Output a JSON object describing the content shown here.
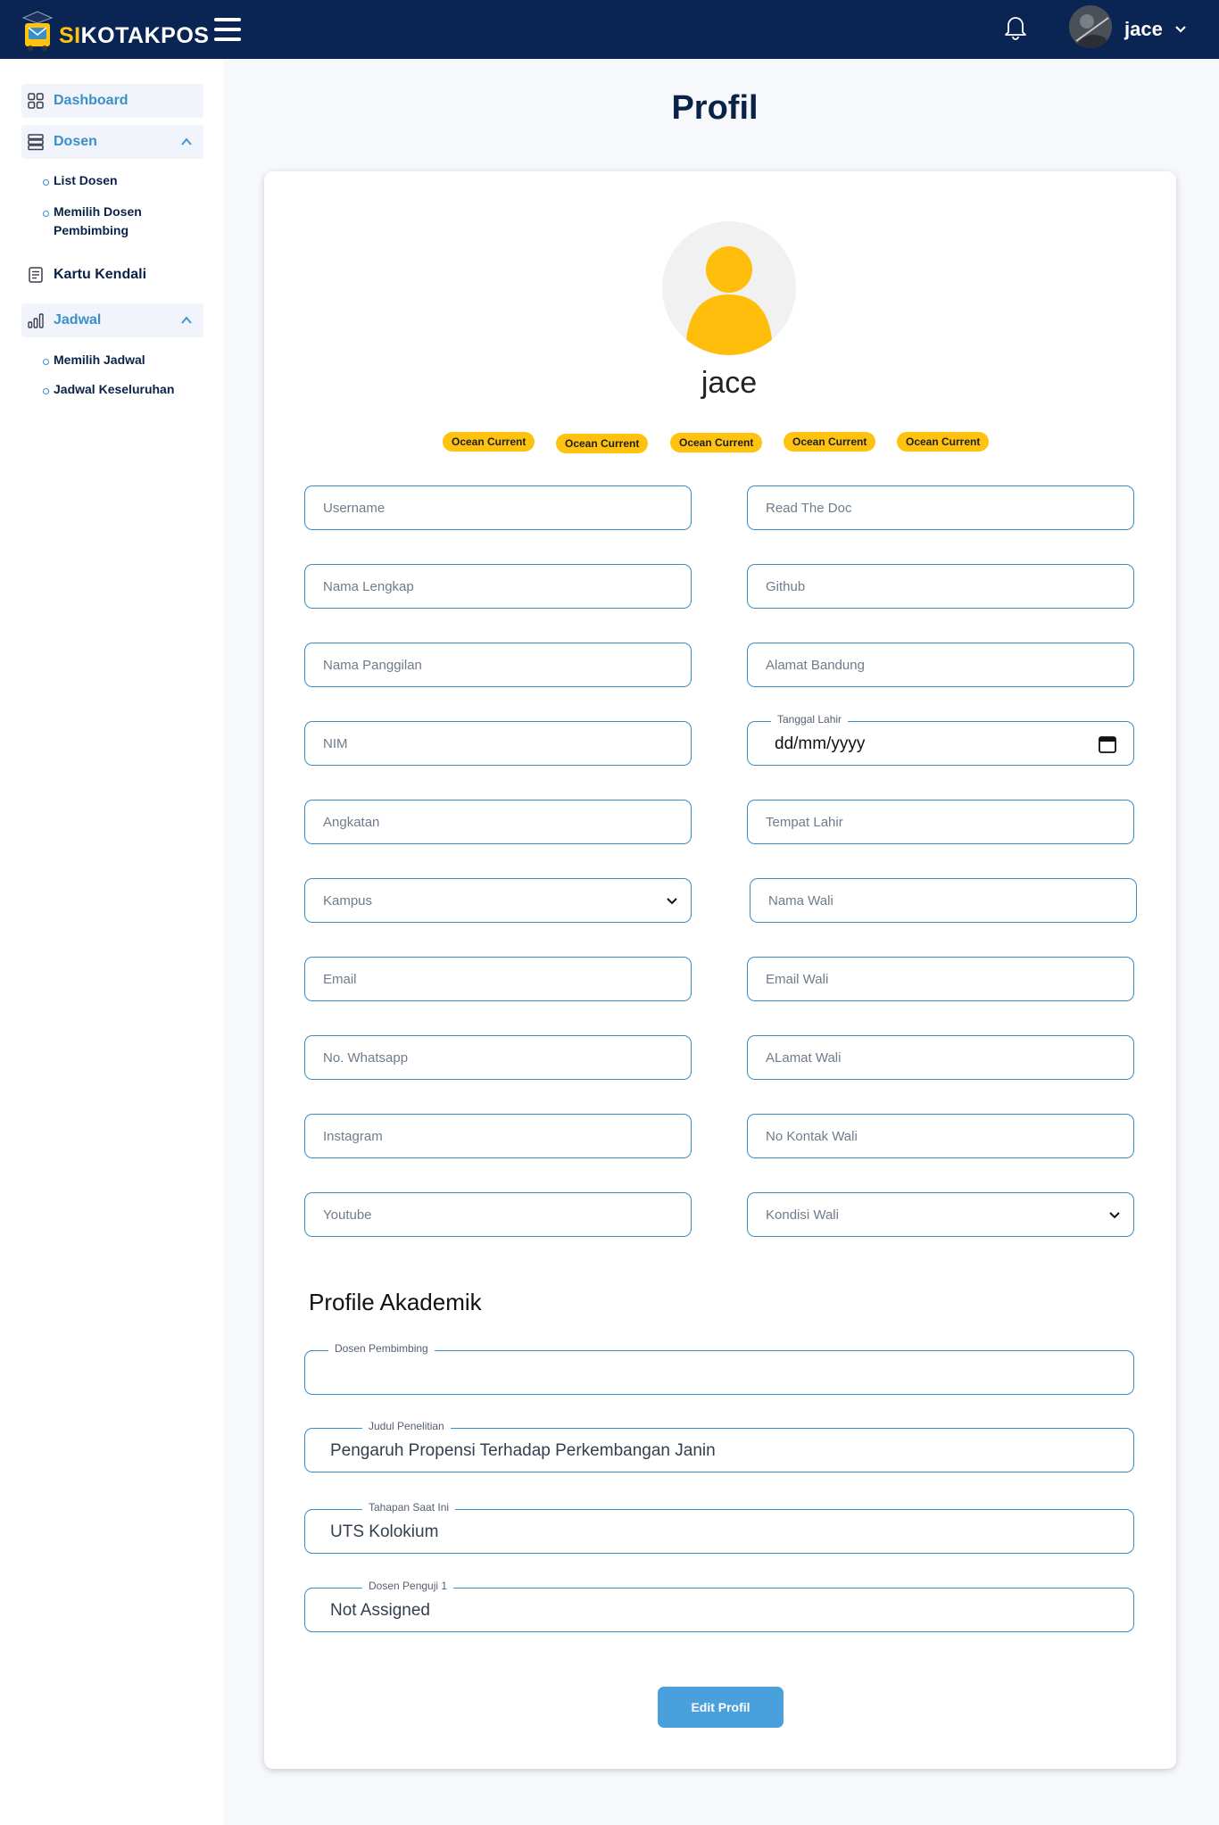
{
  "brand": {
    "prefix": "SI",
    "rest": "KOTAKPOS"
  },
  "topbar": {
    "username": "jace"
  },
  "sidebar": {
    "items": [
      {
        "label": "Dashboard",
        "icon": "dashboard-grid-icon"
      },
      {
        "label": "Dosen",
        "icon": "server-stack-icon",
        "expanded": true
      },
      {
        "label": "Kartu Kendali",
        "icon": "document-icon"
      },
      {
        "label": "Jadwal",
        "icon": "bar-chart-icon",
        "expanded": true
      }
    ],
    "dosen_sub": [
      "List Dosen",
      "Memilih Dosen Pembimbing"
    ],
    "jadwal_sub": [
      "Memilih Jadwal",
      "Jadwal Keseluruhan"
    ]
  },
  "page": {
    "title": "Profil"
  },
  "profile": {
    "name": "jace",
    "badges": [
      "Ocean Current",
      "Ocean Current",
      "Ocean Current",
      "Ocean Current",
      "Ocean Current"
    ]
  },
  "form": {
    "left": [
      "Username",
      "Nama Lengkap",
      "Nama Panggilan",
      "NIM",
      "Angkatan",
      "Kampus",
      "Email",
      "No. Whatsapp",
      "Instagram",
      "Youtube"
    ],
    "right": [
      "Read The Doc",
      "Github",
      "Alamat Bandung",
      "Tanggal Lahir",
      "Tempat Lahir",
      "Nama Wali",
      "Email Wali",
      "ALamat Wali",
      "No Kontak Wali",
      "Kondisi Wali"
    ],
    "date_placeholder": "dd/mm/yyyy"
  },
  "akademik": {
    "title": "Profile Akademik",
    "fields": [
      {
        "label": "Dosen Pembimbing",
        "value": ""
      },
      {
        "label": "Judul Penelitian",
        "value": "Pengaruh Propensi Terhadap Perkembangan Janin"
      },
      {
        "label": "Tahapan Saat Ini",
        "value": "UTS Kolokium"
      },
      {
        "label": "Dosen Penguji 1",
        "value": "Not Assigned"
      }
    ]
  },
  "actions": {
    "edit_label": "Edit Profil"
  },
  "colors": {
    "navy": "#0a2554",
    "accent": "#ffc20e",
    "field_border": "#3a8fc8",
    "button": "#4aa0dc"
  }
}
